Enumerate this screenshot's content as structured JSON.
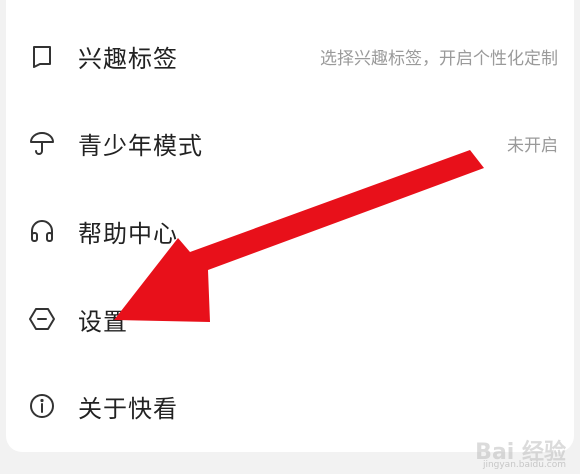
{
  "menu": {
    "items": [
      {
        "icon": "tag-icon",
        "label": "兴趣标签",
        "value": "选择兴趣标签，开启个性化定制"
      },
      {
        "icon": "umbrella-icon",
        "label": "青少年模式",
        "value": "未开启"
      },
      {
        "icon": "headphones-icon",
        "label": "帮助中心",
        "value": ""
      },
      {
        "icon": "settings-hexagon-icon",
        "label": "设置",
        "value": ""
      },
      {
        "icon": "info-icon",
        "label": "关于快看",
        "value": ""
      }
    ]
  },
  "annotation": {
    "arrow_color": "#e8101a"
  },
  "watermark": {
    "text": "Bai 经验",
    "sub": "jingyan.baidu.com"
  }
}
